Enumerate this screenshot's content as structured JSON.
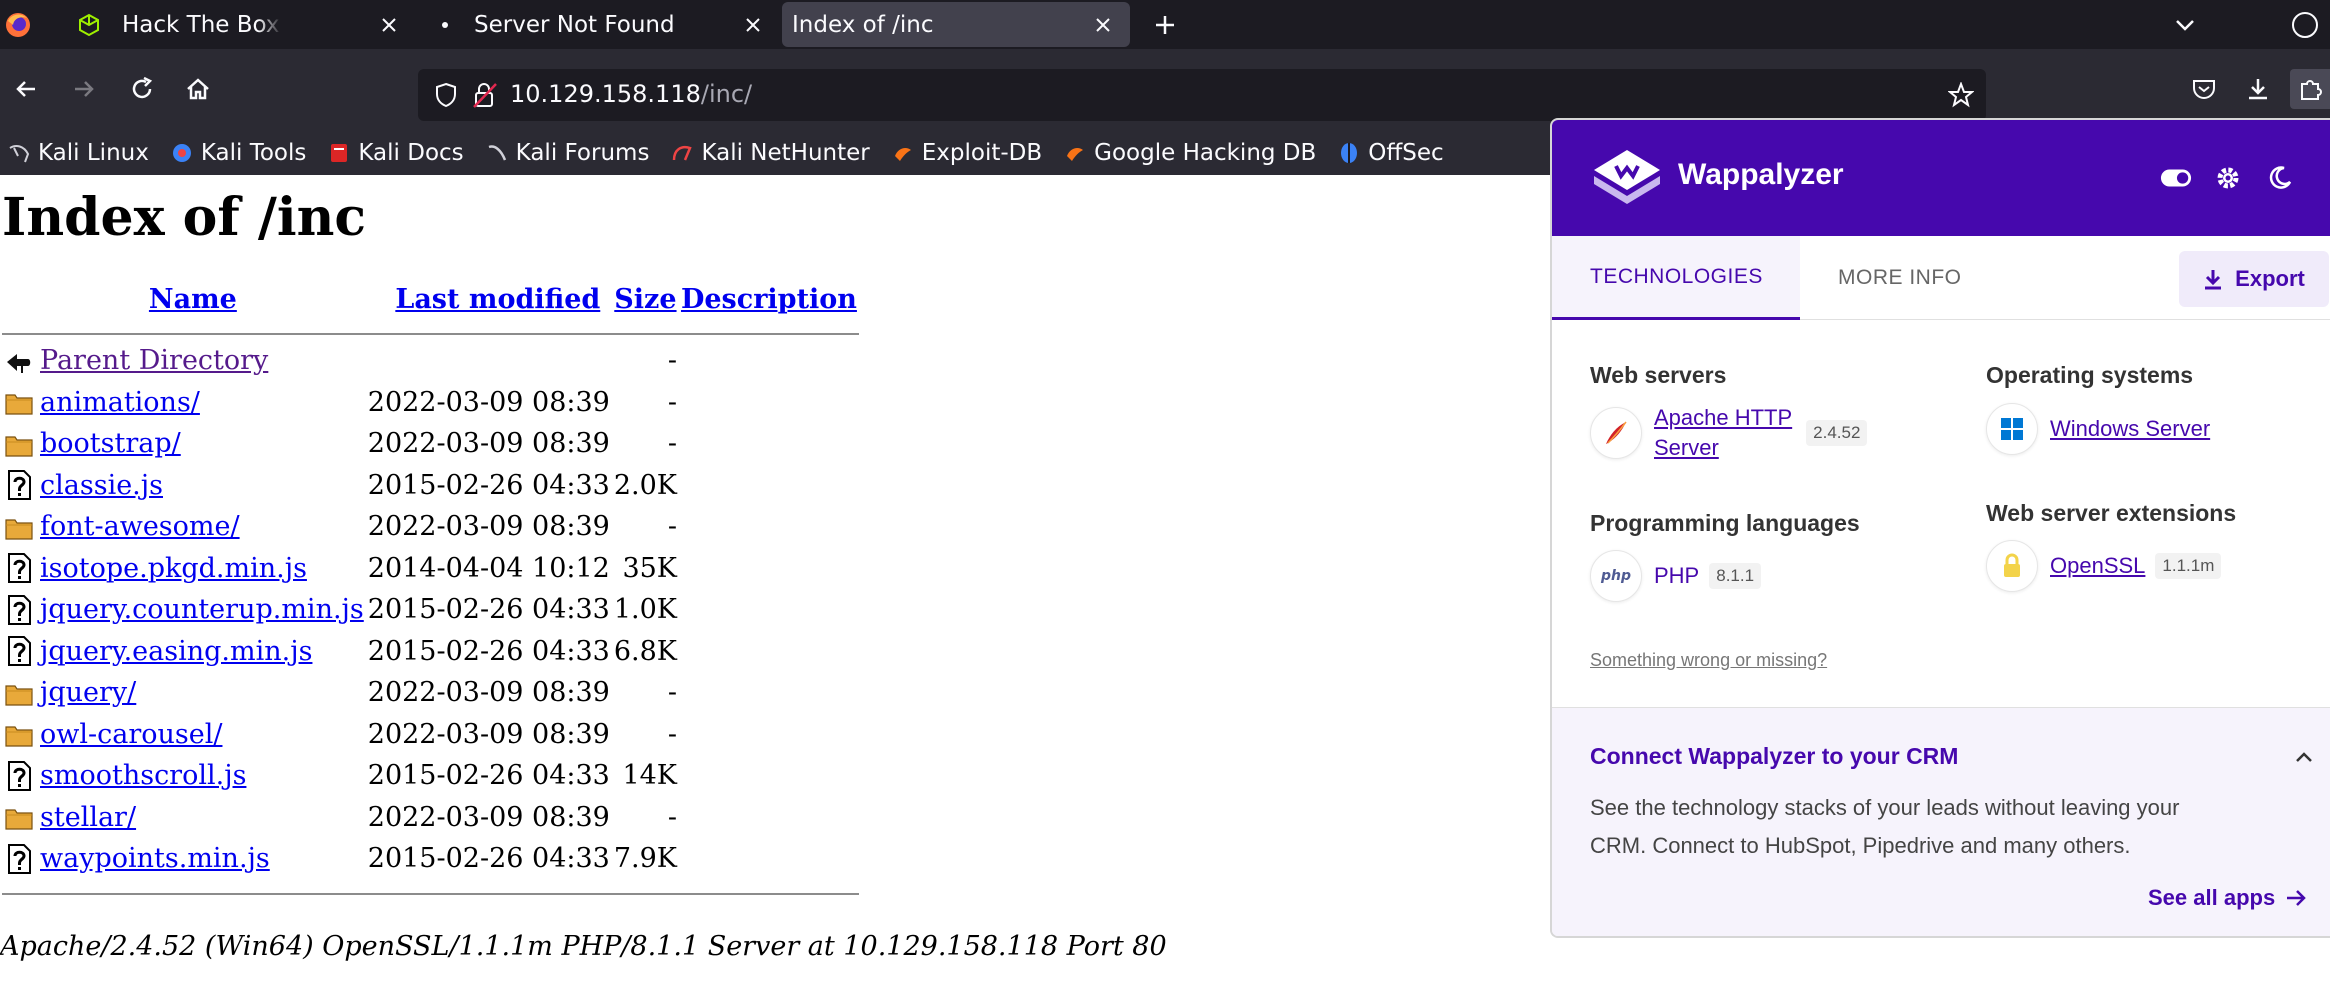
{
  "browser": {
    "tabs": [
      {
        "title": "Hack The Box :: Starting Point",
        "active": false
      },
      {
        "title": "Server Not Found",
        "active": false
      },
      {
        "title": "Index of /inc",
        "active": true
      }
    ],
    "url_host": "10.129.158.118",
    "url_path": "/inc/",
    "bookmarks": [
      "Kali Linux",
      "Kali Tools",
      "Kali Docs",
      "Kali Forums",
      "Kali NetHunter",
      "Exploit-DB",
      "Google Hacking DB",
      "OffSec"
    ]
  },
  "page": {
    "heading": "Index of /inc",
    "columns": {
      "name": "Name",
      "modified": "Last modified",
      "size": "Size",
      "description": "Description"
    },
    "rows": [
      {
        "icon": "back",
        "name": "Parent Directory",
        "modified": "",
        "size": "-"
      },
      {
        "icon": "folder",
        "name": "animations/",
        "modified": "2022-03-09 08:39",
        "size": "-"
      },
      {
        "icon": "folder",
        "name": "bootstrap/",
        "modified": "2022-03-09 08:39",
        "size": "-"
      },
      {
        "icon": "file",
        "name": "classie.js",
        "modified": "2015-02-26 04:33",
        "size": "2.0K"
      },
      {
        "icon": "folder",
        "name": "font-awesome/",
        "modified": "2022-03-09 08:39",
        "size": "-"
      },
      {
        "icon": "file",
        "name": "isotope.pkgd.min.js",
        "modified": "2014-04-04 10:12",
        "size": "35K"
      },
      {
        "icon": "file",
        "name": "jquery.counterup.min.js",
        "modified": "2015-02-26 04:33",
        "size": "1.0K"
      },
      {
        "icon": "file",
        "name": "jquery.easing.min.js",
        "modified": "2015-02-26 04:33",
        "size": "6.8K"
      },
      {
        "icon": "folder",
        "name": "jquery/",
        "modified": "2022-03-09 08:39",
        "size": "-"
      },
      {
        "icon": "folder",
        "name": "owl-carousel/",
        "modified": "2022-03-09 08:39",
        "size": "-"
      },
      {
        "icon": "file",
        "name": "smoothscroll.js",
        "modified": "2015-02-26 04:33",
        "size": "14K"
      },
      {
        "icon": "folder",
        "name": "stellar/",
        "modified": "2022-03-09 08:39",
        "size": "-"
      },
      {
        "icon": "file",
        "name": "waypoints.min.js",
        "modified": "2015-02-26 04:33",
        "size": "7.9K"
      }
    ],
    "footer": "Apache/2.4.52 (Win64) OpenSSL/1.1.1m PHP/8.1.1 Server at 10.129.158.118 Port 80"
  },
  "wappalyzer": {
    "title": "Wappalyzer",
    "tab_technologies": "TECHNOLOGIES",
    "tab_more_info": "MORE INFO",
    "export_label": "Export",
    "web_servers": {
      "category": "Web servers",
      "name_line1": "Apache HTTP",
      "name_line2": "Server",
      "version": "2.4.52"
    },
    "operating_systems": {
      "category": "Operating systems",
      "name": "Windows Server"
    },
    "programming_languages": {
      "category": "Programming languages",
      "name": "PHP",
      "version": "8.1.1",
      "icon_text": "php"
    },
    "web_server_extensions": {
      "category": "Web server extensions",
      "name": "OpenSSL",
      "version": "1.1.1m"
    },
    "something_wrong": "Something wrong or missing?",
    "crm": {
      "title": "Connect Wappalyzer to your CRM",
      "text_line1": "See the technology stacks of your leads without leaving your",
      "text_line2": "CRM. Connect to HubSpot, Pipedrive and many others.",
      "see_all": "See all apps"
    },
    "brand_color": "#4608ad"
  }
}
